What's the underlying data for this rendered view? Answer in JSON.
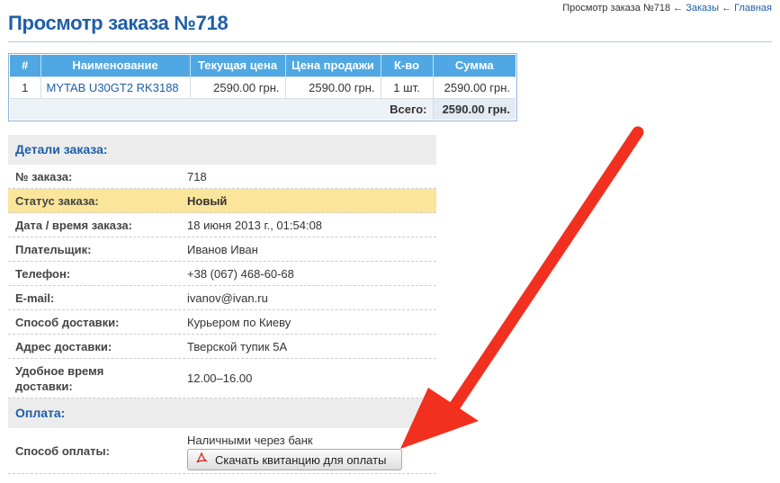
{
  "header": {
    "title": "Просмотр заказа №718",
    "breadcrumb": {
      "current": "Просмотр заказа №718",
      "separator": "←",
      "orders": "Заказы",
      "home": "Главная"
    }
  },
  "order_table": {
    "columns": [
      "#",
      "Наименование",
      "Текущая цена",
      "Цена продажи",
      "К-во",
      "Сумма"
    ],
    "rows": [
      [
        "1",
        "MYTAB U30GT2 RK3188",
        "2590.00 грн.",
        "2590.00 грн.",
        "1 шт.",
        "2590.00 грн."
      ]
    ],
    "total_label": "Всего:",
    "total_value": "2590.00 грн."
  },
  "details": {
    "section_title": "Детали заказа:",
    "order_number_label": "№ заказа:",
    "order_number": "718",
    "status_label": "Статус заказа:",
    "status": "Новый",
    "datetime_label": "Дата / время заказа:",
    "datetime": "18 июня 2013 г., 01:54:08",
    "payer_label": "Плательщик:",
    "payer": "Иванов Иван",
    "phone_label": "Телефон:",
    "phone": "+38 (067) 468-60-68",
    "email_label": "E-mail:",
    "email": "ivanov@ivan.ru",
    "delivery_method_label": "Способ доставки:",
    "delivery_method": "Курьером по Киеву",
    "delivery_address_label": "Адрес доставки:",
    "delivery_address": "Тверской тупик 5А",
    "delivery_time_label_line1": "Удобное время",
    "delivery_time_label_line2": "доставки:",
    "delivery_time": "12.00–16.00"
  },
  "payment": {
    "section_title": "Оплата:",
    "method_label": "Способ оплаты:",
    "method": "Наличными через банк",
    "download_button": "Скачать квитанцию для оплаты"
  },
  "colors": {
    "accent": "#1f5ea8",
    "table_header": "#4fa8e3",
    "status_highlight": "#fbe59a",
    "arrow": "#f2301f"
  }
}
